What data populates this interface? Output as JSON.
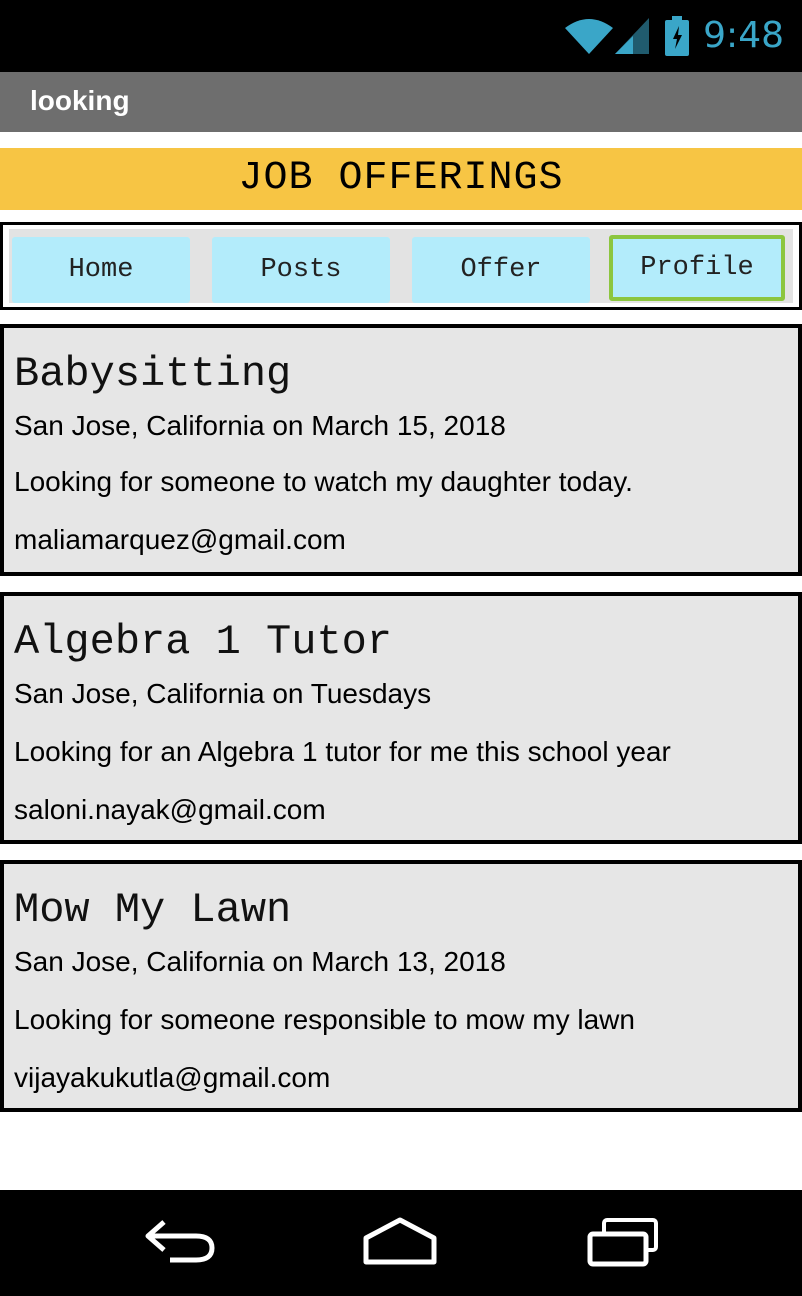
{
  "status_bar": {
    "time": "9:48",
    "icons": [
      "wifi-icon",
      "signal-icon",
      "battery-icon"
    ]
  },
  "app": {
    "title": "looking"
  },
  "banner": {
    "text": "JOB OFFERINGS"
  },
  "nav": {
    "tabs": [
      {
        "label": "Home",
        "active": false
      },
      {
        "label": "Posts",
        "active": false
      },
      {
        "label": "Offer",
        "active": false
      },
      {
        "label": "Profile",
        "active": true
      }
    ]
  },
  "offerings": [
    {
      "title": "Babysitting",
      "location": "San Jose, California on March 15, 2018",
      "description": "Looking for someone to watch my daughter today.",
      "email": "maliamarquez@gmail.com"
    },
    {
      "title": "Algebra 1 Tutor",
      "location": "San Jose, California on Tuesdays",
      "description": "Looking for an Algebra 1 tutor for me this school year",
      "email": "saloni.nayak@gmail.com"
    },
    {
      "title": "Mow My Lawn",
      "location": "San Jose, California on March 13, 2018",
      "description": "Looking for someone responsible to mow my lawn",
      "email": "vijayakukutla@gmail.com"
    }
  ],
  "system_nav": {
    "icons": [
      "back-icon",
      "home-icon",
      "recent-apps-icon"
    ]
  },
  "colors": {
    "banner": "#f7c544",
    "tab": "#b3ecfb",
    "active_tab_border": "#8cc63f",
    "title_bar": "#6e6e6e",
    "card": "#e6e6e6"
  }
}
